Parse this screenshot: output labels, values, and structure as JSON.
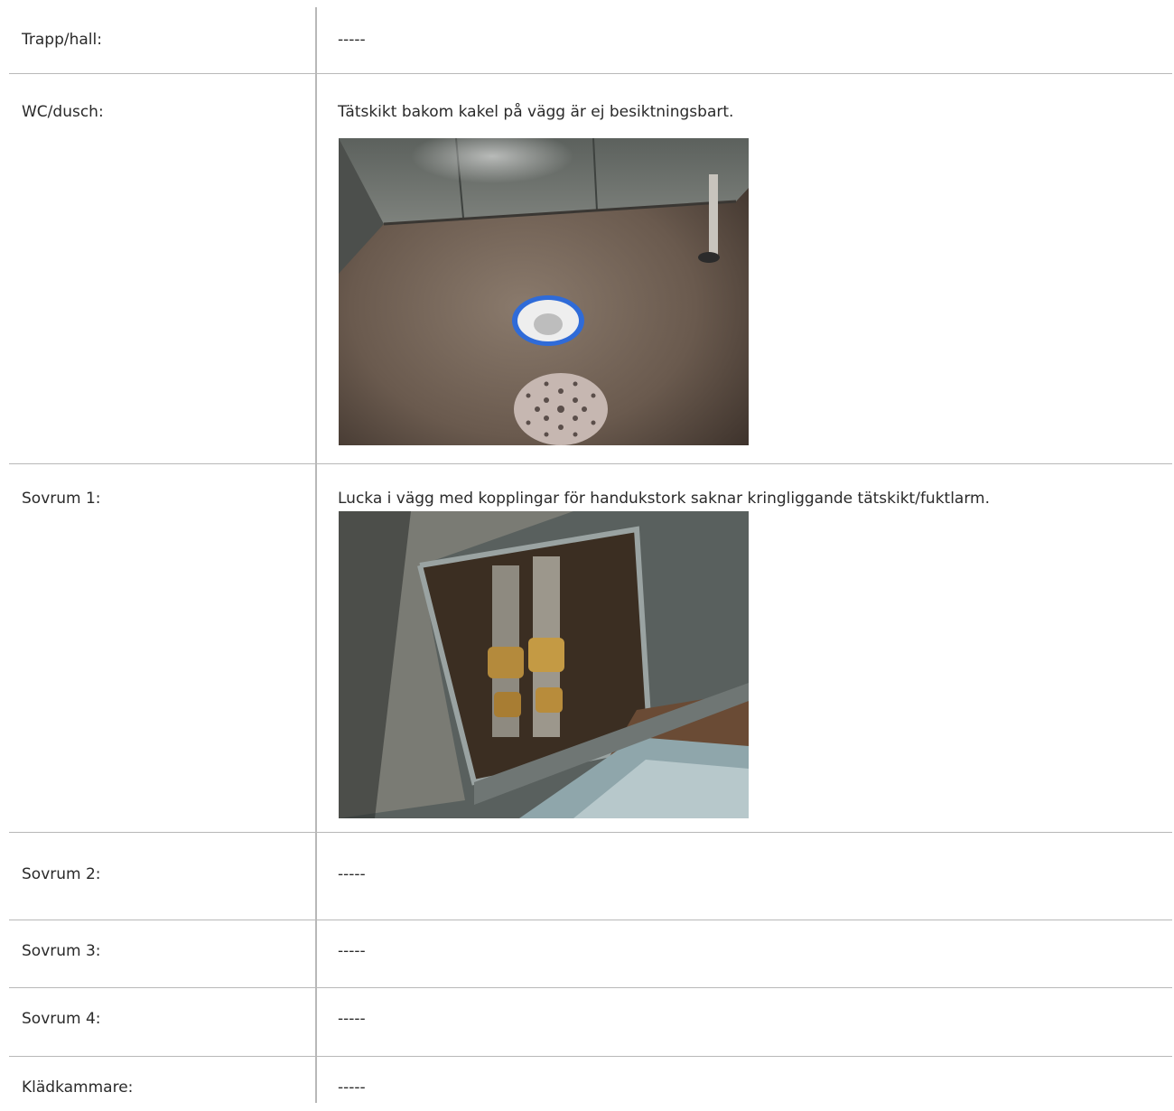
{
  "rows": [
    {
      "label": "Trapp/hall:",
      "value": "-----"
    },
    {
      "label": "WC/dusch:",
      "value": "Tätskikt bakom kakel på vägg är ej besiktningsbart."
    },
    {
      "label": "Sovrum 1:",
      "value": "Lucka i vägg med kopplingar för handukstork saknar kringliggande tätskikt/fuktlarm."
    },
    {
      "label": "Sovrum 2:",
      "value": "-----"
    },
    {
      "label": "Sovrum 3:",
      "value": "-----"
    },
    {
      "label": "Sovrum 4:",
      "value": "-----"
    },
    {
      "label": "Klädkammare:",
      "value": "-----"
    }
  ],
  "photos": [
    {
      "subject": "shower floor drain with removed grate"
    },
    {
      "subject": "wall hatch with towel warmer pipe couplings"
    }
  ]
}
